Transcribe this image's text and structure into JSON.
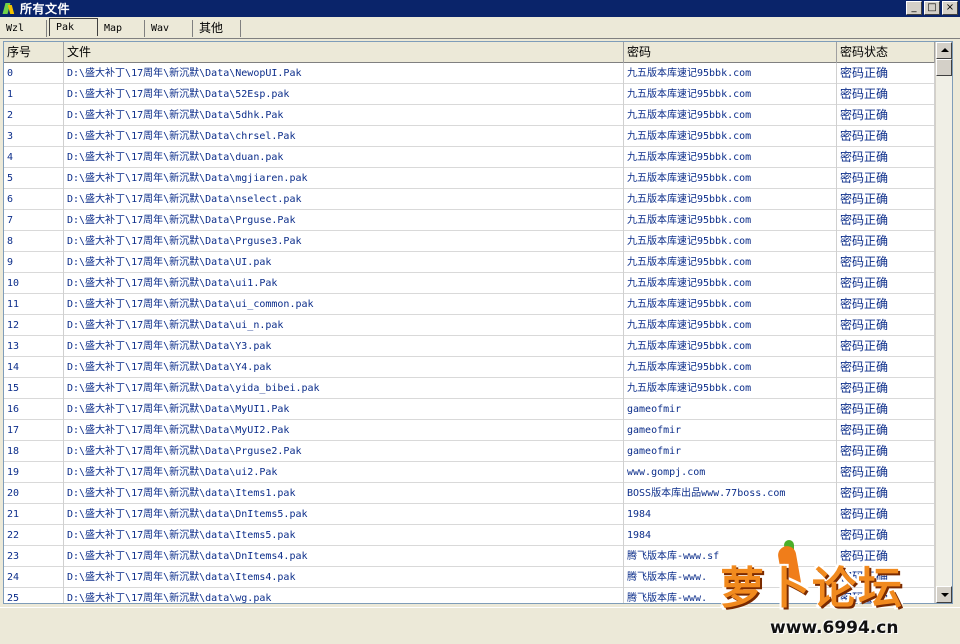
{
  "window": {
    "title": "所有文件",
    "min": "_",
    "max": "□",
    "close": "×"
  },
  "tabs": [
    {
      "label": "Wzl"
    },
    {
      "label": "Pak"
    },
    {
      "label": "Map"
    },
    {
      "label": "Wav"
    },
    {
      "label": "其他"
    }
  ],
  "active_tab": "Pak",
  "table": {
    "headers": [
      "序号",
      "文件",
      "密码",
      "密码状态"
    ],
    "rows": [
      [
        "0",
        "D:\\盛大补丁\\17周年\\新沉默\\Data\\NewopUI.Pak",
        "九五版本库速记95bbk.com",
        "密码正确"
      ],
      [
        "1",
        "D:\\盛大补丁\\17周年\\新沉默\\Data\\52Esp.pak",
        "九五版本库速记95bbk.com",
        "密码正确"
      ],
      [
        "2",
        "D:\\盛大补丁\\17周年\\新沉默\\Data\\5dhk.Pak",
        "九五版本库速记95bbk.com",
        "密码正确"
      ],
      [
        "3",
        "D:\\盛大补丁\\17周年\\新沉默\\Data\\chrsel.Pak",
        "九五版本库速记95bbk.com",
        "密码正确"
      ],
      [
        "4",
        "D:\\盛大补丁\\17周年\\新沉默\\Data\\duan.pak",
        "九五版本库速记95bbk.com",
        "密码正确"
      ],
      [
        "5",
        "D:\\盛大补丁\\17周年\\新沉默\\Data\\mgjiaren.pak",
        "九五版本库速记95bbk.com",
        "密码正确"
      ],
      [
        "6",
        "D:\\盛大补丁\\17周年\\新沉默\\Data\\nselect.pak",
        "九五版本库速记95bbk.com",
        "密码正确"
      ],
      [
        "7",
        "D:\\盛大补丁\\17周年\\新沉默\\Data\\Prguse.Pak",
        "九五版本库速记95bbk.com",
        "密码正确"
      ],
      [
        "8",
        "D:\\盛大补丁\\17周年\\新沉默\\Data\\Prguse3.Pak",
        "九五版本库速记95bbk.com",
        "密码正确"
      ],
      [
        "9",
        "D:\\盛大补丁\\17周年\\新沉默\\Data\\UI.pak",
        "九五版本库速记95bbk.com",
        "密码正确"
      ],
      [
        "10",
        "D:\\盛大补丁\\17周年\\新沉默\\Data\\ui1.Pak",
        "九五版本库速记95bbk.com",
        "密码正确"
      ],
      [
        "11",
        "D:\\盛大补丁\\17周年\\新沉默\\Data\\ui_common.pak",
        "九五版本库速记95bbk.com",
        "密码正确"
      ],
      [
        "12",
        "D:\\盛大补丁\\17周年\\新沉默\\Data\\ui_n.pak",
        "九五版本库速记95bbk.com",
        "密码正确"
      ],
      [
        "13",
        "D:\\盛大补丁\\17周年\\新沉默\\Data\\Y3.pak",
        "九五版本库速记95bbk.com",
        "密码正确"
      ],
      [
        "14",
        "D:\\盛大补丁\\17周年\\新沉默\\Data\\Y4.pak",
        "九五版本库速记95bbk.com",
        "密码正确"
      ],
      [
        "15",
        "D:\\盛大补丁\\17周年\\新沉默\\Data\\yida_bibei.pak",
        "九五版本库速记95bbk.com",
        "密码正确"
      ],
      [
        "16",
        "D:\\盛大补丁\\17周年\\新沉默\\Data\\MyUI1.Pak",
        "gameofmir",
        "密码正确"
      ],
      [
        "17",
        "D:\\盛大补丁\\17周年\\新沉默\\Data\\MyUI2.Pak",
        "gameofmir",
        "密码正确"
      ],
      [
        "18",
        "D:\\盛大补丁\\17周年\\新沉默\\Data\\Prguse2.Pak",
        "gameofmir",
        "密码正确"
      ],
      [
        "19",
        "D:\\盛大补丁\\17周年\\新沉默\\Data\\ui2.Pak",
        "www.gompj.com",
        "密码正确"
      ],
      [
        "20",
        "D:\\盛大补丁\\17周年\\新沉默\\data\\Items1.pak",
        "BOSS版本库出品www.77boss.com",
        "密码正确"
      ],
      [
        "21",
        "D:\\盛大补丁\\17周年\\新沉默\\data\\DnItems5.pak",
        "1984",
        "密码正确"
      ],
      [
        "22",
        "D:\\盛大补丁\\17周年\\新沉默\\data\\Items5.pak",
        "1984",
        "密码正确"
      ],
      [
        "23",
        "D:\\盛大补丁\\17周年\\新沉默\\data\\DnItems4.pak",
        "腾飞版本库-www.sf",
        "密码正确"
      ],
      [
        "24",
        "D:\\盛大补丁\\17周年\\新沉默\\data\\Items4.pak",
        "腾飞版本库-www.",
        "密码正确"
      ],
      [
        "25",
        "D:\\盛大补丁\\17周年\\新沉默\\data\\wg.pak",
        "腾飞版本库-www.",
        "密码正确"
      ]
    ]
  },
  "watermark": {
    "title": "萝卜论坛",
    "url": "www.6994.cn"
  },
  "colors": {
    "titlebar": "#0a246a",
    "row_text": "#0b2d8a",
    "watermark": "#f18a1e"
  }
}
